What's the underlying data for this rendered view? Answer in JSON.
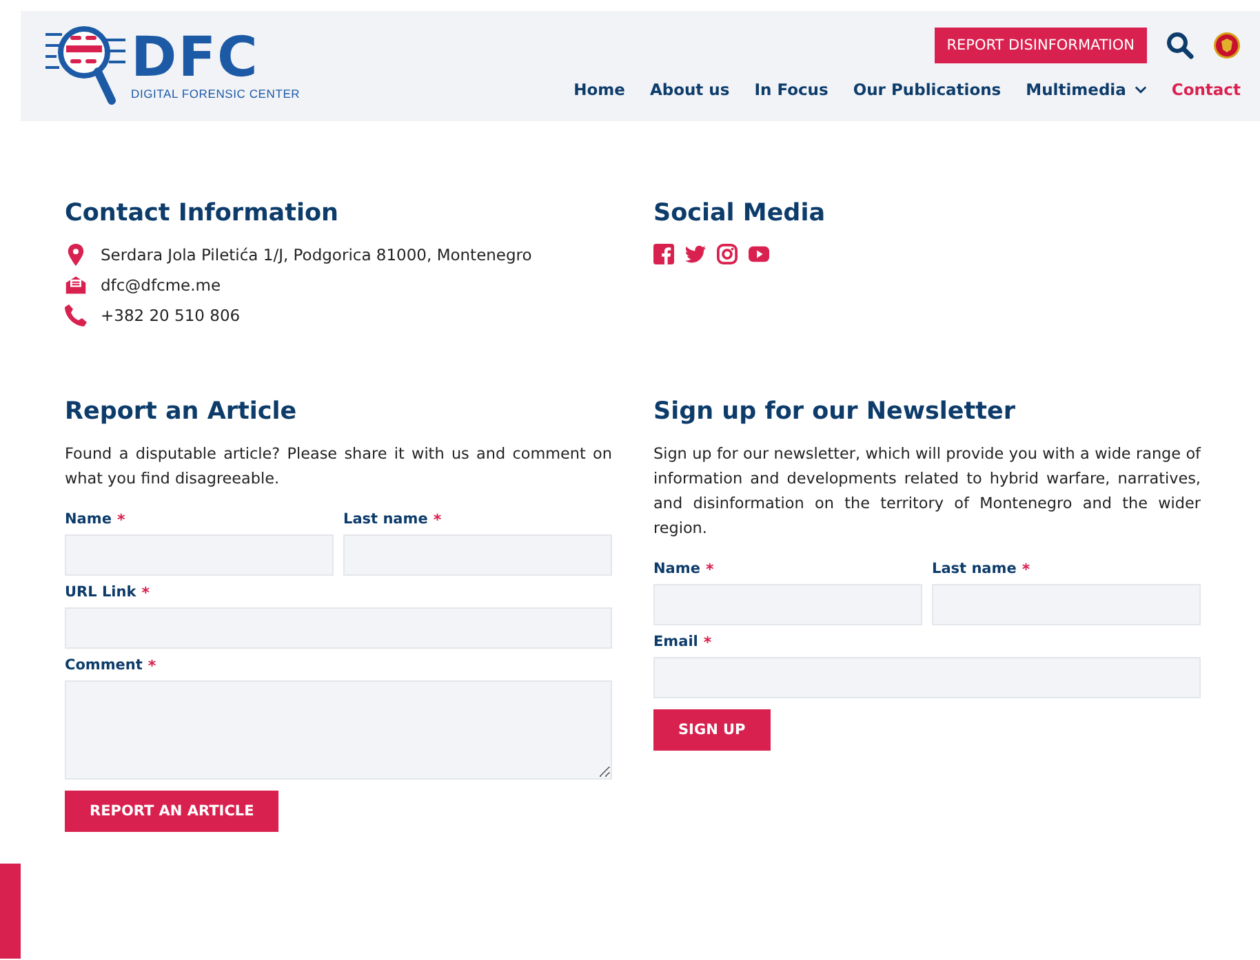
{
  "header": {
    "logo": {
      "title": "DFC",
      "subtitle": "DIGITAL FORENSIC CENTER"
    },
    "report_button": "REPORT DISINFORMATION",
    "nav": [
      {
        "label": "Home",
        "selected": false,
        "dropdown": false
      },
      {
        "label": "About us",
        "selected": false,
        "dropdown": false
      },
      {
        "label": "In Focus",
        "selected": false,
        "dropdown": false
      },
      {
        "label": "Our Publications",
        "selected": false,
        "dropdown": false
      },
      {
        "label": "Multimedia",
        "selected": false,
        "dropdown": true
      },
      {
        "label": "Contact",
        "selected": true,
        "dropdown": false
      }
    ]
  },
  "contact": {
    "title": "Contact Information",
    "items": [
      {
        "kind": "pin",
        "text": "Serdara Jola Piletića 1/J, Podgorica 81000, Montenegro"
      },
      {
        "kind": "mail",
        "text": "dfc@dfcme.me"
      },
      {
        "kind": "phone",
        "text": "+382 20 510 806"
      }
    ]
  },
  "social": {
    "title": "Social Media",
    "icons": [
      {
        "kind": "facebook"
      },
      {
        "kind": "twitter"
      },
      {
        "kind": "instagram"
      },
      {
        "kind": "youtube"
      }
    ]
  },
  "report": {
    "title": "Report an Article",
    "text": "Found a disputable article? Please share it with us and comment on what you find disagreeable.",
    "rows": [
      [
        {
          "label": "Name",
          "required_mark": "*",
          "kind": "input"
        },
        {
          "label": "Last name",
          "required_mark": "*",
          "kind": "input"
        }
      ],
      [
        {
          "label": "URL Link",
          "required_mark": "*",
          "kind": "input"
        }
      ],
      [
        {
          "label": "Comment",
          "required_mark": "*",
          "kind": "textarea"
        }
      ]
    ],
    "button": "REPORT AN ARTICLE"
  },
  "newsletter": {
    "title": "Sign up for our Newsletter",
    "text": "Sign up for our newsletter, which will provide you with a wide range of information and developments related to hybrid warfare, narratives, and disinformation on the territory of Montenegro and the wider region.",
    "rows": [
      [
        {
          "label": "Name",
          "required_mark": "*",
          "kind": "input"
        },
        {
          "label": "Last name",
          "required_mark": "*",
          "kind": "input"
        }
      ],
      [
        {
          "label": "Email",
          "required_mark": "*",
          "kind": "input"
        }
      ]
    ],
    "button": "SIGN UP"
  }
}
